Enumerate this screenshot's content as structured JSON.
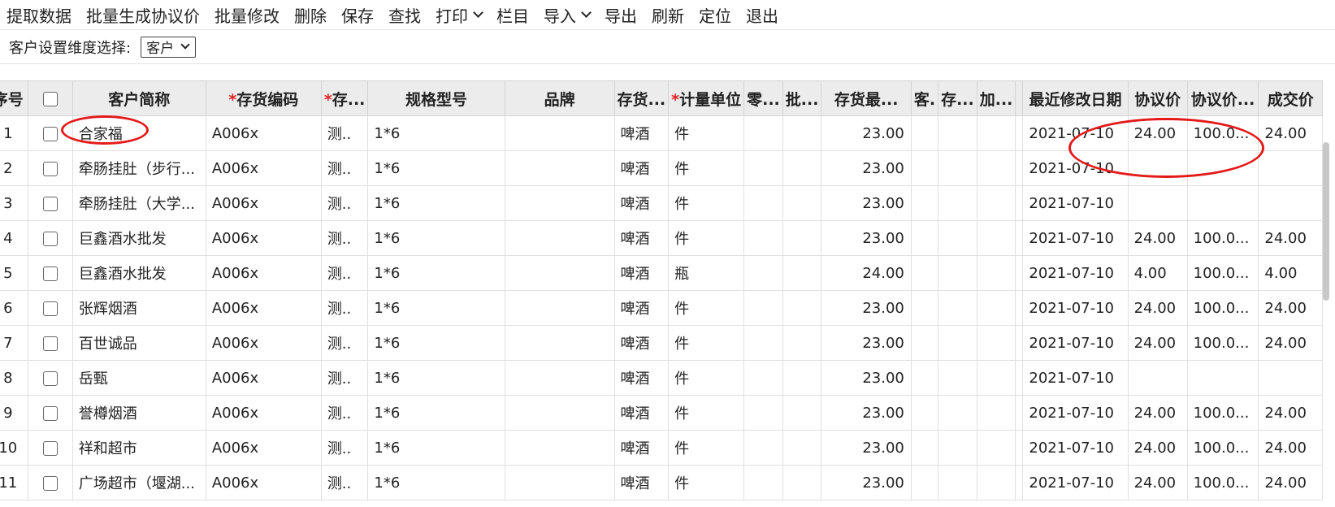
{
  "toolbar": {
    "items": [
      "提取数据",
      "批量生成协议价",
      "批量修改",
      "删除",
      "保存",
      "查找",
      "打印",
      "栏目",
      "导入",
      "导出",
      "刷新",
      "定位",
      "退出"
    ]
  },
  "dimension": {
    "label": "客户设置维度选择:",
    "value": "客户"
  },
  "table": {
    "headers": [
      "序号",
      "",
      "客户简称",
      "存货编码",
      "存...",
      "规格型号",
      "品牌",
      "存货...",
      "计量单位",
      "零...",
      "批...",
      "存货最...",
      "客.",
      "存...",
      "加...",
      "",
      "最近修改日期",
      "协议价",
      "协议价...",
      "成交价"
    ],
    "required_cols": [
      3,
      4,
      8
    ],
    "rows": [
      [
        "1",
        "合家福",
        "A006x",
        "测..",
        "1*6",
        "",
        "啤酒",
        "件",
        "23.00",
        "2021-07-10",
        "24.00",
        "100.0...",
        "24.00"
      ],
      [
        "2",
        "牵肠挂肚（步行...",
        "A006x",
        "测..",
        "1*6",
        "",
        "啤酒",
        "件",
        "23.00",
        "2021-07-10",
        "",
        "",
        ""
      ],
      [
        "3",
        "牵肠挂肚（大学...",
        "A006x",
        "测..",
        "1*6",
        "",
        "啤酒",
        "件",
        "23.00",
        "2021-07-10",
        "",
        "",
        ""
      ],
      [
        "4",
        "巨鑫酒水批发",
        "A006x",
        "测..",
        "1*6",
        "",
        "啤酒",
        "件",
        "23.00",
        "2021-07-10",
        "24.00",
        "100.0...",
        "24.00"
      ],
      [
        "5",
        "巨鑫酒水批发",
        "A006x",
        "测..",
        "1*6",
        "",
        "啤酒",
        "瓶",
        "24.00",
        "2021-07-10",
        "4.00",
        "100.0...",
        "4.00"
      ],
      [
        "6",
        "张辉烟酒",
        "A006x",
        "测..",
        "1*6",
        "",
        "啤酒",
        "件",
        "23.00",
        "2021-07-10",
        "24.00",
        "100.0...",
        "24.00"
      ],
      [
        "7",
        "百世诚品",
        "A006x",
        "测..",
        "1*6",
        "",
        "啤酒",
        "件",
        "23.00",
        "2021-07-10",
        "24.00",
        "100.0...",
        "24.00"
      ],
      [
        "8",
        "岳甄",
        "A006x",
        "测..",
        "1*6",
        "",
        "啤酒",
        "件",
        "23.00",
        "2021-07-10",
        "",
        "",
        ""
      ],
      [
        "9",
        "誉樽烟酒",
        "A006x",
        "测..",
        "1*6",
        "",
        "啤酒",
        "件",
        "23.00",
        "2021-07-10",
        "24.00",
        "100.0...",
        "24.00"
      ],
      [
        "10",
        "祥和超市",
        "A006x",
        "测..",
        "1*6",
        "",
        "啤酒",
        "件",
        "23.00",
        "2021-07-10",
        "24.00",
        "100.0...",
        "24.00"
      ],
      [
        "11",
        "广场超市（堰湖...",
        "A006x",
        "测..",
        "1*6",
        "",
        "啤酒",
        "件",
        "23.00",
        "2021-07-10",
        "24.00",
        "100.0...",
        "24.00"
      ]
    ]
  },
  "colors": {
    "annotation": "#e31a1a",
    "header_bg": "#ececec",
    "required": "#e02020"
  }
}
